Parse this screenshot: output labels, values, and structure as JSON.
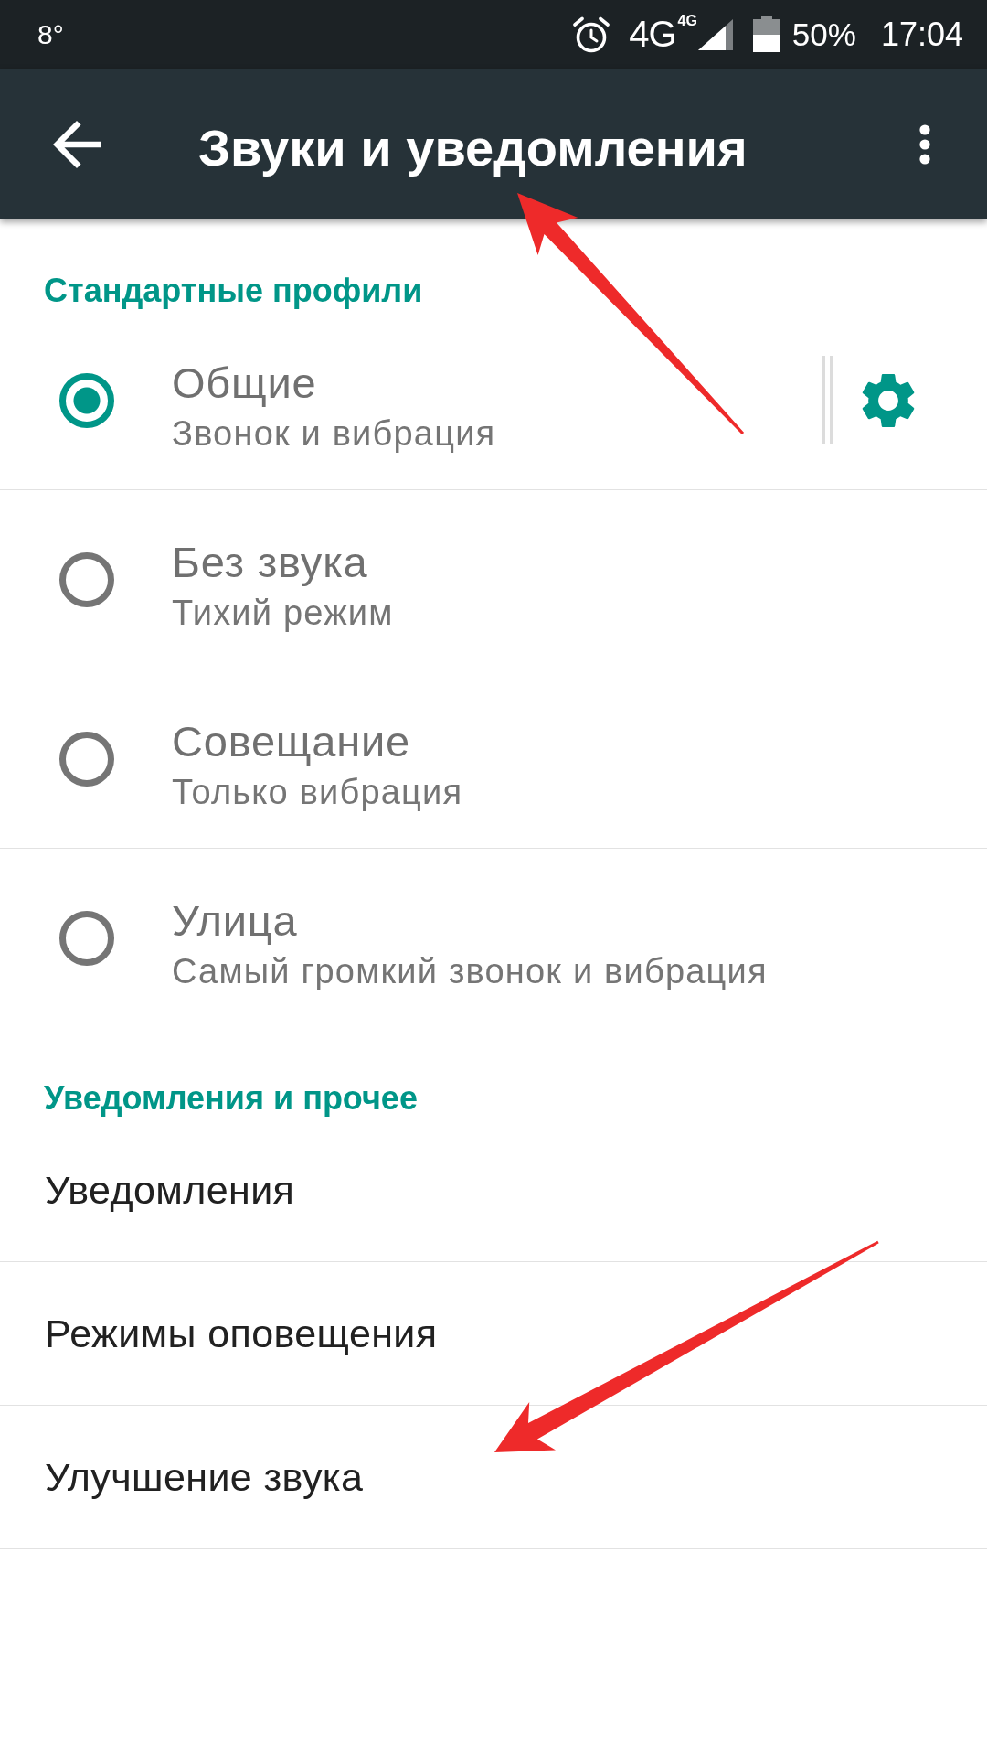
{
  "status_bar": {
    "temperature": "8°",
    "network": "4G",
    "signal_label": "4G",
    "battery": "50%",
    "time": "17:04"
  },
  "toolbar": {
    "title": "Звуки и уведомления"
  },
  "sections": [
    {
      "kind": "profiles",
      "header": "Стандартные профили",
      "items": [
        {
          "title": "Общие",
          "subtitle": "Звонок и вибрация",
          "selected": true,
          "settings": true
        },
        {
          "title": "Без звука",
          "subtitle": "Тихий режим",
          "selected": false,
          "settings": false
        },
        {
          "title": "Совещание",
          "subtitle": "Только вибрация",
          "selected": false,
          "settings": false
        },
        {
          "title": "Улица",
          "subtitle": "Самый громкий звонок и вибрация",
          "selected": false,
          "settings": false
        }
      ]
    },
    {
      "kind": "links",
      "header": "Уведомления и прочее",
      "items": [
        {
          "title": "Уведомления"
        },
        {
          "title": "Режимы оповещения"
        },
        {
          "title": "Улучшение звука"
        }
      ]
    }
  ]
}
